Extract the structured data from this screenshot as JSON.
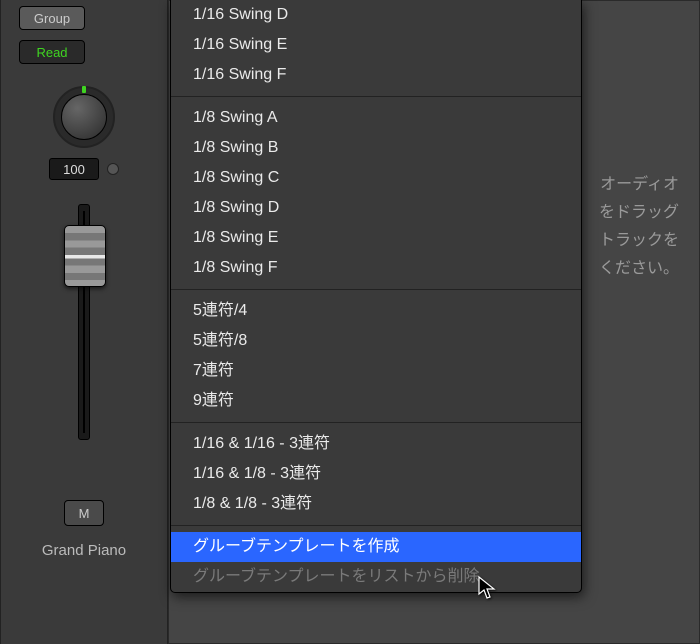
{
  "channel": {
    "group_label": "Group",
    "read_label": "Read",
    "pan_value": "100",
    "mute_label": "M",
    "track_name": "Grand Piano"
  },
  "helper": {
    "text": "オーディオ\nをドラッグ\nトラックを\nください。"
  },
  "menu": {
    "sections": [
      {
        "items": [
          "1/16 Swing D",
          "1/16 Swing E",
          "1/16 Swing F"
        ]
      },
      {
        "items": [
          "1/8 Swing A",
          "1/8 Swing B",
          "1/8 Swing C",
          "1/8 Swing D",
          "1/8 Swing E",
          "1/8 Swing F"
        ]
      },
      {
        "items": [
          "5連符/4",
          "5連符/8",
          "7連符",
          "9連符"
        ]
      },
      {
        "items": [
          "1/16 & 1/16 - 3連符",
          "1/16 & 1/8 - 3連符",
          "1/8 & 1/8 - 3連符"
        ]
      }
    ],
    "footer": {
      "create_template": "グルーブテンプレートを作成",
      "delete_template": "グルーブテンプレートをリストから削除"
    }
  }
}
